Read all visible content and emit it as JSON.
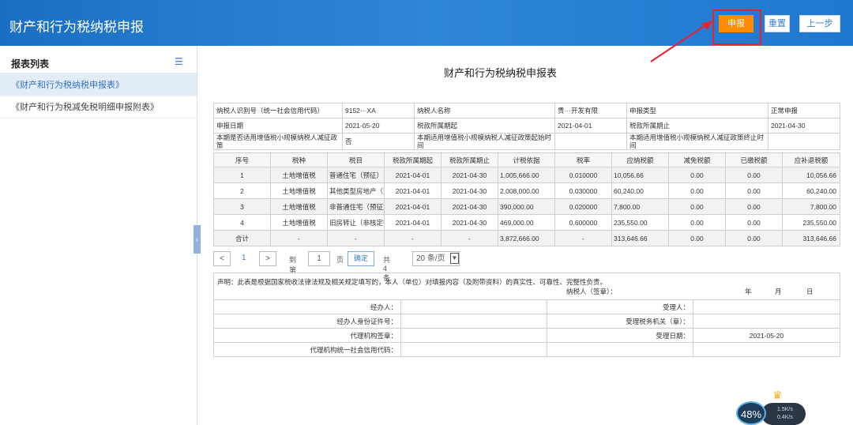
{
  "header": {
    "title": "财产和行为税纳税申报",
    "submit_label": "申报",
    "reset_label": "重置",
    "prev_label": "上一步"
  },
  "sidebar": {
    "title": "报表列表",
    "items": [
      {
        "label": "《财产和行为税纳税申报表》",
        "active": true
      },
      {
        "label": "《财产和行为税减免税明细申报附表》",
        "active": false
      }
    ]
  },
  "form": {
    "title": "财产和行为税纳税申报表",
    "info": {
      "taxpayer_id_label": "纳税人识别号（统一社会信用代码）",
      "taxpayer_id_value": "9152···XA",
      "taxpayer_name_label": "纳税人名称",
      "taxpayer_name_value": "贵···开发有限",
      "decl_type_label": "申报类型",
      "decl_type_value": "正常申报",
      "decl_date_label": "申报日期",
      "decl_date_value": "2021-05-20",
      "period_start_label": "税款所属期起",
      "period_start_value": "2021-04-01",
      "period_end_label": "税款所属期止",
      "period_end_value": "2021-04-30",
      "small_scale_label": "本期是否适用增值税小规模纳税人减征政策",
      "small_scale_value": "否",
      "small_start_label": "本期适用增值税小规模纳税人减征政策起始时间",
      "small_start_value": "",
      "small_end_label": "本期适用增值税小规模纳税人减征政策终止时间",
      "small_end_value": ""
    },
    "columns": [
      "序号",
      "税种",
      "税目",
      "税款所属期起",
      "税款所属期止",
      "计税依据",
      "税率",
      "应纳税额",
      "减免税额",
      "已缴税额",
      "应补退税额"
    ],
    "rows": [
      [
        "1",
        "土地增值税",
        "普通住宅（预征）",
        "2021-04-01",
        "2021-04-30",
        "1,005,666.00",
        "0.010000",
        "10,056.66",
        "0.00",
        "0.00",
        "10,056.66"
      ],
      [
        "2",
        "土地增值税",
        "其他类型房地产（预征）",
        "2021-04-01",
        "2021-04-30",
        "2,008,000.00",
        "0.030000",
        "60,240.00",
        "0.00",
        "0.00",
        "60,240.00"
      ],
      [
        "3",
        "土地增值税",
        "非普通住宅（预征）",
        "2021-04-01",
        "2021-04-30",
        "390,000.00",
        "0.020000",
        "7,800.00",
        "0.00",
        "0.00",
        "7,800.00"
      ],
      [
        "4",
        "土地增值税",
        "旧房转让（非核定征收）",
        "2021-04-01",
        "2021-04-30",
        "469,000.00",
        "0.600000",
        "235,550.00",
        "0.00",
        "0.00",
        "235,550.00"
      ],
      [
        "合计",
        "-",
        "-",
        "-",
        "-",
        "3,872,666.00",
        "-",
        "313,646.66",
        "0.00",
        "0.00",
        "313,646.66"
      ]
    ],
    "pager": {
      "prev": "<",
      "current": "1",
      "next": ">",
      "goto_label": "到第",
      "goto_value": "1",
      "page_label": "页",
      "confirm": "确定",
      "total": "共 4 条",
      "page_size": "20 条/页"
    },
    "declaration": {
      "statement": "声明：此表是根据国家税收法律法规及相关规定填写的，本人（单位）对填报内容（及附带资料）的真实性、可靠性、完整性负责。",
      "taxpayer_sign": "纳税人（签章）：",
      "year": "年",
      "month": "月",
      "day": "日",
      "handler": "经办人：",
      "receiver": "受理人：",
      "handler_id": "经办人身份证件号：",
      "tax_office": "受理税务机关（章）：",
      "agency_seal": "代理机构签章：",
      "accept_date_label": "受理日期：",
      "accept_date": "2021-05-20",
      "agency_code": "代理机构统一社会信用代码："
    }
  },
  "widget": {
    "percent": "48%",
    "up": "1.5K/s",
    "down": "0.4K/s"
  },
  "colors": {
    "header": "#1e78cf",
    "submit": "#ff8c00",
    "highlight": "#e8212f"
  }
}
